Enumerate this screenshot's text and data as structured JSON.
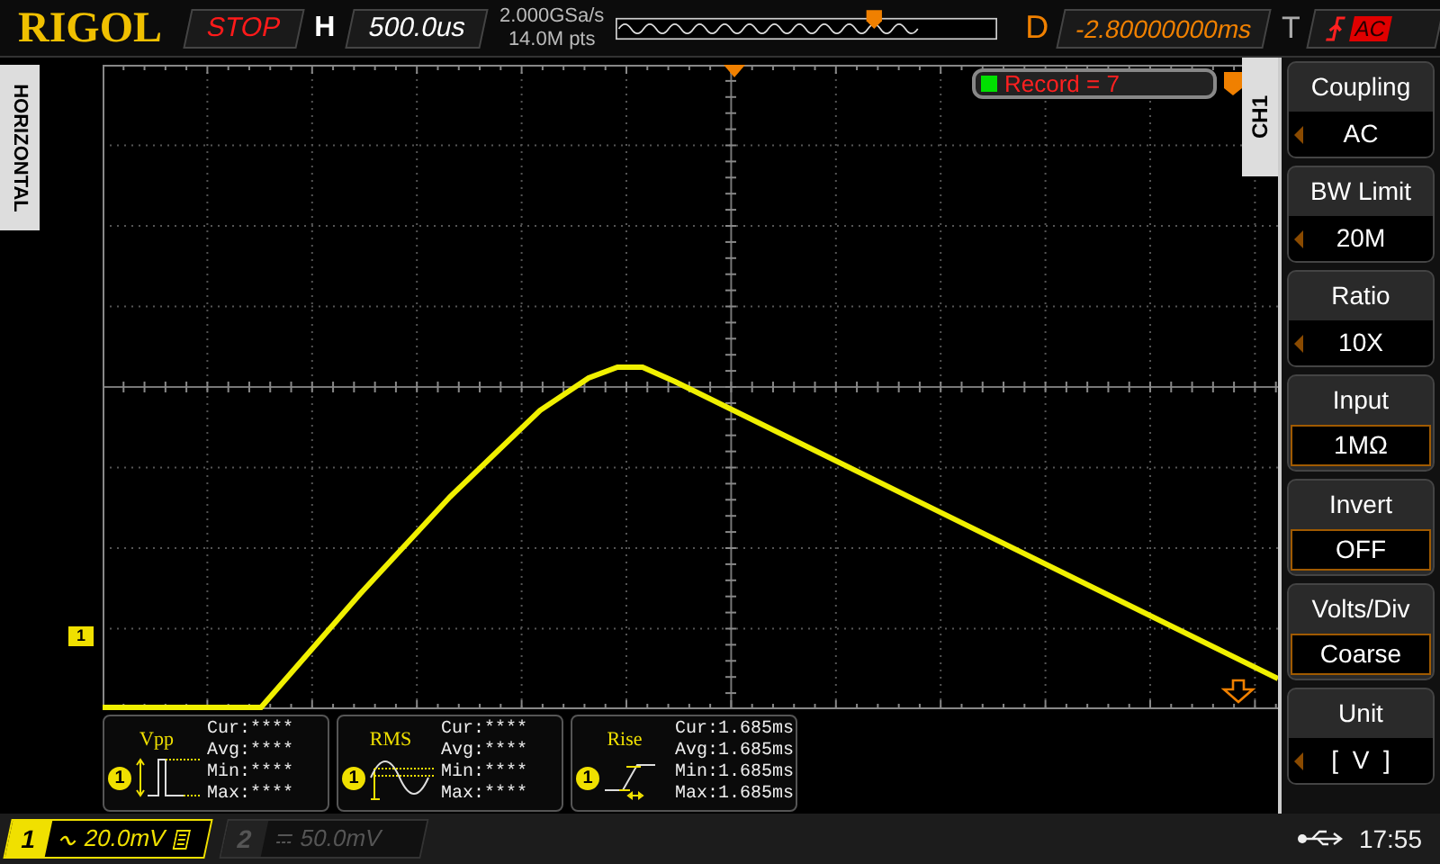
{
  "header": {
    "brand": "RIGOL",
    "run_state": "STOP",
    "timebase_label": "H",
    "timebase": "500.0us",
    "sample_rate": "2.000GSa/s",
    "memory_depth": "14.0M pts",
    "delay_label": "D",
    "delay": "-2.80000000ms",
    "trigger_label": "T",
    "trigger_coupling": "AC"
  },
  "side_tab": "HORIZONTAL",
  "record": "Record = 7",
  "channel_marker": "1",
  "measurements": [
    {
      "name": "Vpp",
      "kind": "vpp",
      "channel": "1",
      "lines": [
        "Cur:****",
        "Avg:****",
        "Min:****",
        "Max:****"
      ]
    },
    {
      "name": "RMS",
      "kind": "rms",
      "channel": "1",
      "lines": [
        "Cur:****",
        "Avg:****",
        "Min:****",
        "Max:****"
      ]
    },
    {
      "name": "Rise",
      "kind": "rise",
      "channel": "1",
      "lines": [
        "Cur:1.685ms",
        "Avg:1.685ms",
        "Min:1.685ms",
        "Max:1.685ms"
      ]
    }
  ],
  "menu": {
    "tab": "CH1",
    "items": [
      {
        "label": "Coupling",
        "value": "AC",
        "kind": "select"
      },
      {
        "label": "BW Limit",
        "value": "20M",
        "kind": "select"
      },
      {
        "label": "Ratio",
        "value": "10X",
        "kind": "select"
      },
      {
        "label": "Input",
        "value": "1MΩ",
        "kind": "toggle"
      },
      {
        "label": "Invert",
        "value": "OFF",
        "kind": "toggle"
      },
      {
        "label": "Volts/Div",
        "value": "Coarse",
        "kind": "toggle"
      },
      {
        "label": "Unit",
        "value": "[  V  ]",
        "kind": "select"
      }
    ]
  },
  "channels": [
    {
      "number": "1",
      "ac_coupled": true,
      "scale": "20.0mV",
      "enabled": true,
      "bw_limited": true
    },
    {
      "number": "2",
      "ac_coupled": false,
      "scale": "50.0mV",
      "enabled": false,
      "bw_limited": false
    }
  ],
  "status": {
    "time": "17:55"
  }
}
